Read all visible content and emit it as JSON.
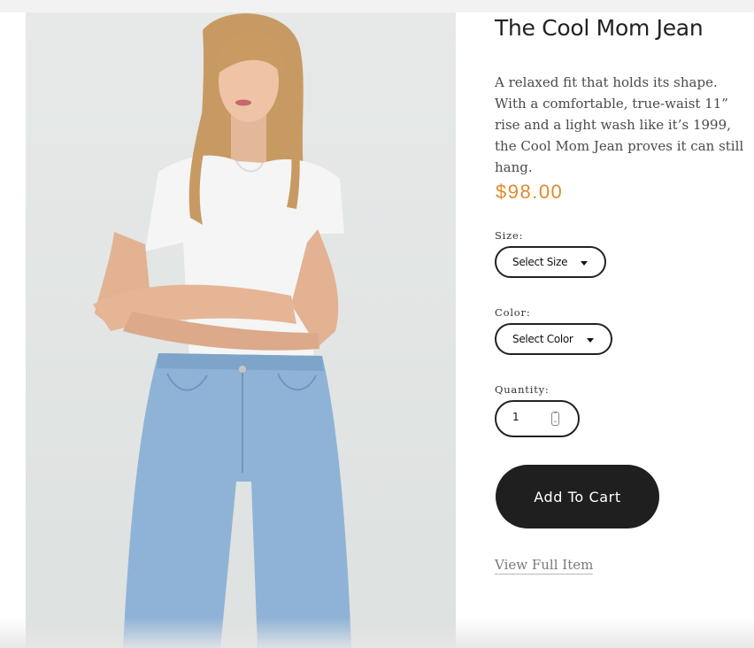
{
  "product": {
    "title": "The Cool Mom Jean",
    "description": "A relaxed fit that holds its shape. With a comfortable, true-waist 11” rise and a light wash like it’s 1999, the Cool Mom Jean proves it can still hang.",
    "price": "$98.00",
    "price_color": "#e08a2c",
    "image_icon": "product-photo"
  },
  "size": {
    "label": "Size:",
    "selected": "Select Size"
  },
  "color": {
    "label": "Color:",
    "selected": "Select Color"
  },
  "quantity": {
    "label": "Quantity:",
    "value": "1"
  },
  "actions": {
    "add_to_cart": "Add To Cart",
    "view_full_item": "View Full Item"
  }
}
